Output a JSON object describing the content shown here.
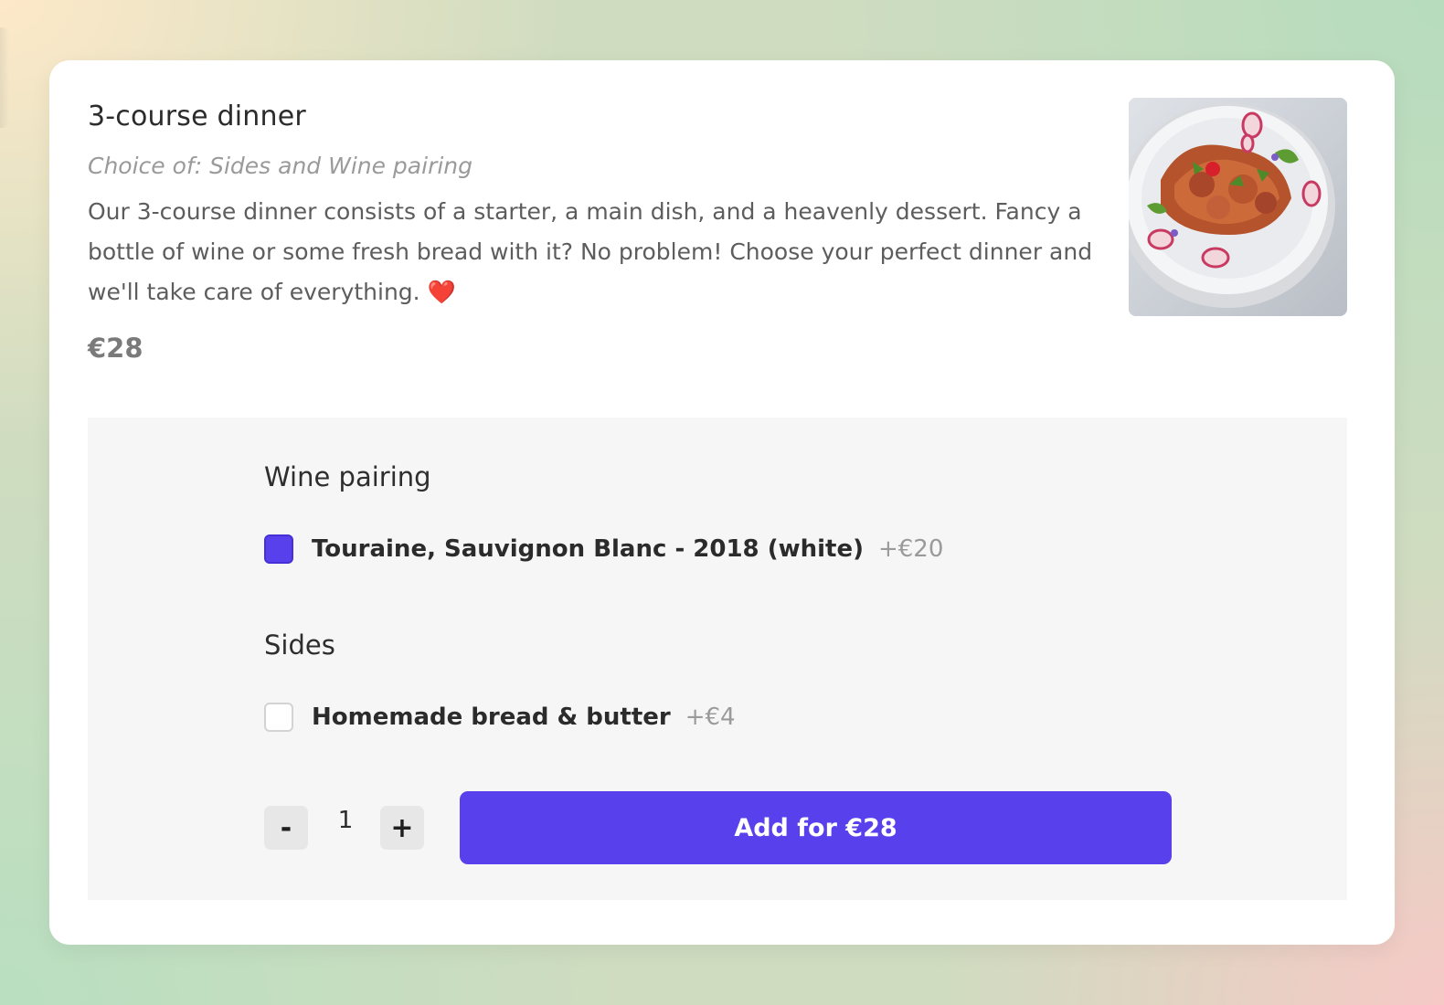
{
  "product": {
    "title": "3-course dinner",
    "subtitle": "Choice of: Sides and Wine pairing",
    "description": "Our 3-course dinner consists of a starter, a main dish, and a heavenly dessert. Fancy a bottle of wine or some fresh bread with it? No problem! Choose your perfect dinner and we'll take care of everything.",
    "description_emoji": "❤️",
    "price": "€28",
    "image_alt": "plated food dish"
  },
  "options": {
    "wine": {
      "title": "Wine pairing",
      "label": "Touraine, Sauvignon Blanc - 2018 (white)",
      "price": "+€20",
      "checked": true
    },
    "sides": {
      "title": "Sides",
      "label": "Homemade bread & butter",
      "price": "+€4",
      "checked": false
    }
  },
  "order": {
    "decrement_label": "-",
    "quantity": "1",
    "increment_label": "+",
    "add_label": "Add for €28"
  },
  "colors": {
    "accent": "#5840ec",
    "panel": "#f6f6f6"
  }
}
